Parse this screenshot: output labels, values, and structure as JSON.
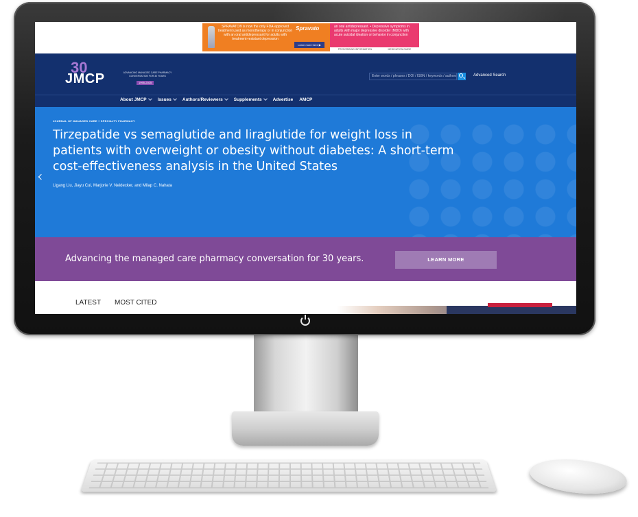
{
  "ad": {
    "left_text": "SPRAVATO® is now the only FDA-approved treatment used as monotherapy or in conjunction with an oral antidepressant for adults with treatment-resistant depression",
    "brand": "Spravato",
    "cta": "Learn more here ▶",
    "right_text": "an oral antidepressant. • Depressive symptoms in adults with major depressive disorder (MDD) with acute suicidal ideation or behavior in conjunction",
    "link_pi": "PRESCRIBING INFORMATION",
    "link_mg": "MEDICATION GUIDE"
  },
  "header": {
    "logo_30": "30",
    "logo_name": "JMCP",
    "logo_tagline": "ADVANCING MANAGED CARE PHARMACY CONVERSATION FOR 30 YEARS",
    "logo_years": "1995-2025",
    "search_placeholder": "Enter words / phrases / DOI / ISBN / keywords / authors",
    "advanced_search": "Advanced Search"
  },
  "nav": {
    "items": [
      {
        "label": "About JMCP",
        "has_dropdown": true
      },
      {
        "label": "Issues",
        "has_dropdown": true
      },
      {
        "label": "Authors/Reviewers",
        "has_dropdown": true
      },
      {
        "label": "Supplements",
        "has_dropdown": true
      },
      {
        "label": "Advertise",
        "has_dropdown": false
      },
      {
        "label": "AMCP",
        "has_dropdown": false
      }
    ]
  },
  "hero": {
    "kicker": "JOURNAL OF MANAGED CARE + SPECIALTY PHARMACY",
    "title": "Tirzepatide vs semaglutide and liraglutide for weight loss in patients with overweight or obesity without diabetes: A short-term cost-effectiveness analysis in the United States",
    "authors": "Ligang Liu, Jiayu Cui, Marjorie V. Neidecker, and Milap C. Nahata"
  },
  "banner": {
    "text": "Advancing the managed care pharmacy conversation for 30 years.",
    "button": "LEARN MORE"
  },
  "tabs": {
    "latest": "LATEST",
    "most_cited": "MOST CITED"
  },
  "colors": {
    "navy": "#13306e",
    "hero_blue": "#1f7ad8",
    "purple": "#7f4a97",
    "ad_orange": "#f07f22",
    "ad_pink": "#ea3a6f"
  }
}
